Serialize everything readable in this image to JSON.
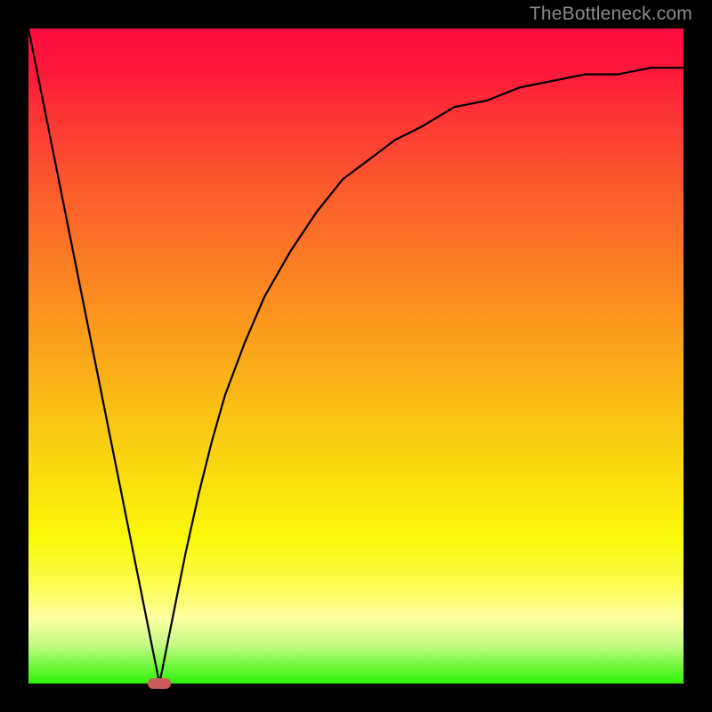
{
  "watermark": "TheBottleneck.com",
  "colors": {
    "curve": "#000000",
    "marker": "#cc5a5f",
    "frame": "#000000",
    "text": "#8b8b8b"
  },
  "chart_data": {
    "type": "line",
    "title": "",
    "xlabel": "",
    "ylabel": "",
    "xlim": [
      0,
      1
    ],
    "ylim": [
      0,
      1
    ],
    "grid": false,
    "legend": false,
    "critical_x": 0.2,
    "critical_y": 0.0,
    "x": [
      0.0,
      0.02,
      0.04,
      0.06,
      0.08,
      0.1,
      0.12,
      0.14,
      0.16,
      0.18,
      0.2,
      0.22,
      0.24,
      0.26,
      0.28,
      0.3,
      0.33,
      0.36,
      0.4,
      0.44,
      0.48,
      0.52,
      0.56,
      0.6,
      0.65,
      0.7,
      0.75,
      0.8,
      0.85,
      0.9,
      0.95,
      1.0
    ],
    "y": [
      1.0,
      0.9,
      0.8,
      0.7,
      0.6,
      0.5,
      0.4,
      0.3,
      0.2,
      0.1,
      0.0,
      0.1,
      0.2,
      0.29,
      0.37,
      0.44,
      0.52,
      0.59,
      0.66,
      0.72,
      0.77,
      0.8,
      0.83,
      0.85,
      0.88,
      0.89,
      0.91,
      0.92,
      0.93,
      0.93,
      0.94,
      0.94
    ]
  }
}
